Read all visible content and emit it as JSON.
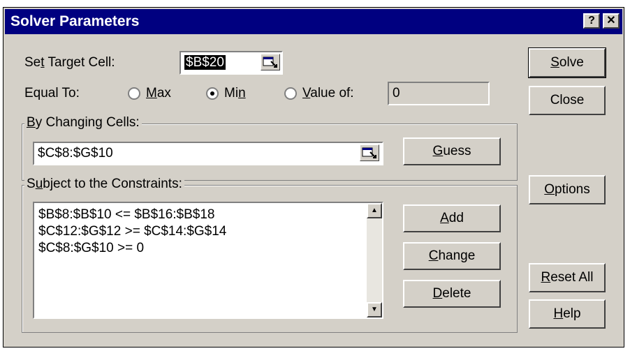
{
  "dialog": {
    "title": "Solver Parameters",
    "help_btn": "?",
    "close_btn": "✕"
  },
  "target": {
    "label_pre": "Se",
    "label_u": "t",
    "label_post": " Target Cell:",
    "value": "$B$20"
  },
  "equal_to": {
    "label": "Equal To:",
    "max_u": "M",
    "max_rest": "ax",
    "min_pre": "Mi",
    "min_u": "n",
    "value_u": "V",
    "value_rest": "alue of:",
    "value_field": "0",
    "selected": "min"
  },
  "changing": {
    "label_u": "B",
    "label_rest": "y Changing Cells:",
    "value": "$C$8:$G$10",
    "guess_u": "G",
    "guess_rest": "uess"
  },
  "constraints": {
    "label_pre": "S",
    "label_u": "u",
    "label_post": "bject to the Constraints:",
    "items": [
      "$B$8:$B$10 <= $B$16:$B$18",
      "$C$12:$G$12 >= $C$14:$G$14",
      "$C$8:$G$10 >= 0"
    ],
    "add_u": "A",
    "add_rest": "dd",
    "change_u": "C",
    "change_rest": "hange",
    "delete_u": "D",
    "delete_rest": "elete"
  },
  "side_buttons": {
    "solve_u": "S",
    "solve_rest": "olve",
    "close": "Close",
    "options_u": "O",
    "options_rest": "ptions",
    "reset_u": "R",
    "reset_rest": "eset All",
    "help_u": "H",
    "help_rest": "elp"
  }
}
